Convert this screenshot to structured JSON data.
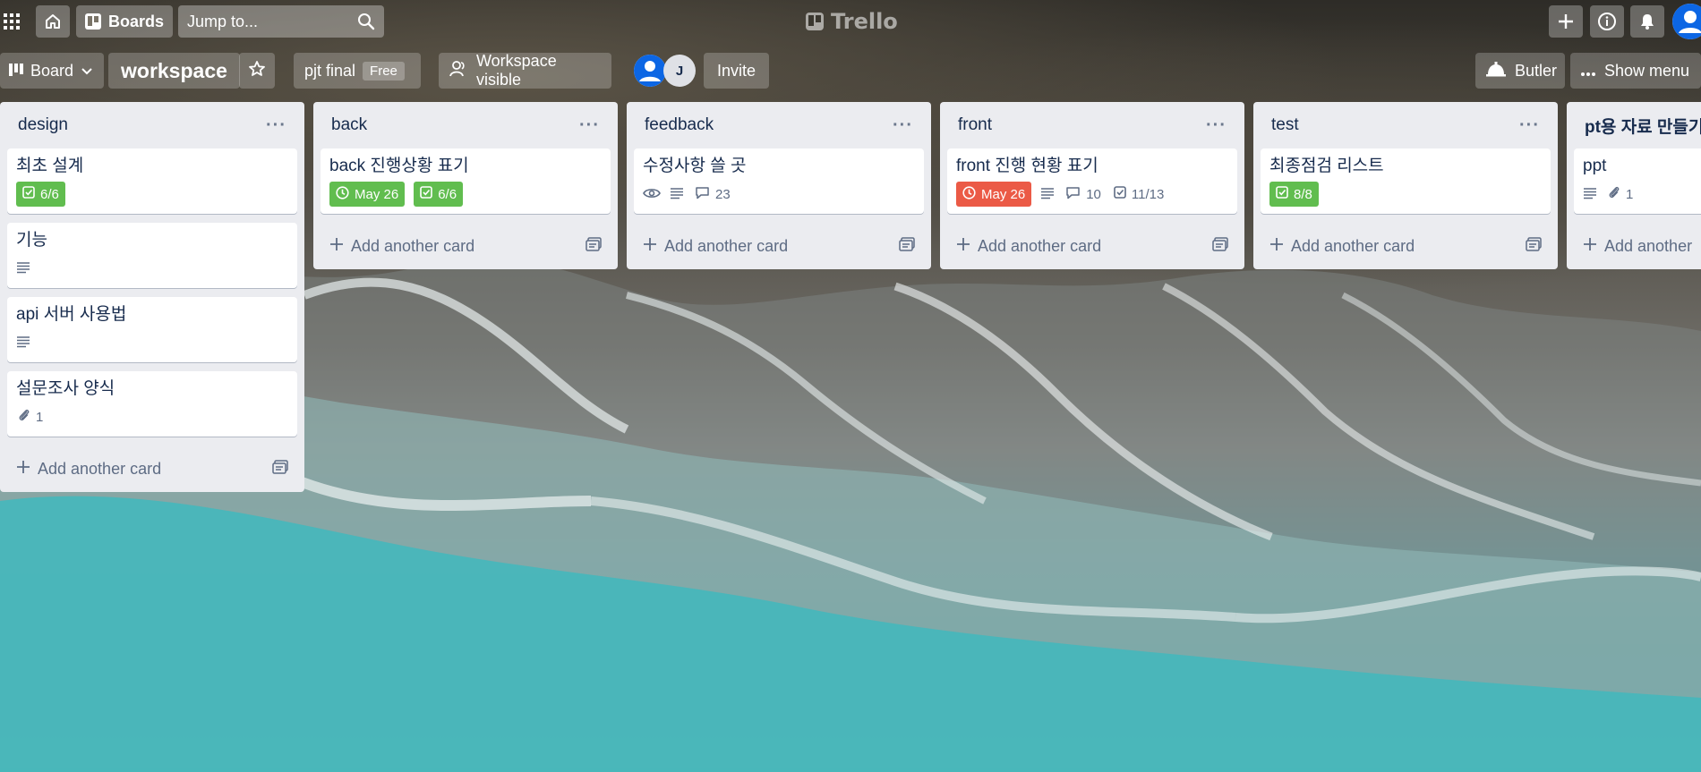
{
  "header": {
    "apps_icon": "grid-icon",
    "home_icon": "home-icon",
    "boards_label": "Boards",
    "search_placeholder": "Jump to...",
    "logo_text": "Trello",
    "create_icon": "plus-icon",
    "info_icon": "info-icon",
    "notifications_icon": "bell-icon",
    "account_icon": "user-avatar-icon"
  },
  "board_header": {
    "view_label": "Board",
    "board_name": "workspace",
    "workspace_name": "pjt final",
    "plan_badge": "Free",
    "visibility_label": "Workspace visible",
    "member_initial": "J",
    "invite_label": "Invite",
    "butler_label": "Butler",
    "show_menu_label": "Show menu"
  },
  "lists": [
    {
      "title": "design",
      "add_card_label": "Add another card",
      "cards": [
        {
          "title": "최초 설계",
          "checklist": "6/6"
        },
        {
          "title": "기능"
        },
        {
          "title": "api 서버 사용법"
        },
        {
          "title": "설문조사 양식",
          "attachments": "1"
        }
      ]
    },
    {
      "title": "back",
      "add_card_label": "Add another card",
      "cards": [
        {
          "title": "back 진행상황 표기",
          "due": "May 26",
          "checklist": "6/6"
        }
      ]
    },
    {
      "title": "feedback",
      "add_card_label": "Add another card",
      "cards": [
        {
          "title": "수정사항 쓸 곳",
          "comments": "23"
        }
      ]
    },
    {
      "title": "front",
      "add_card_label": "Add another card",
      "cards": [
        {
          "title": "front 진행 현황 표기",
          "due": "May 26",
          "comments": "10",
          "checklist": "11/13"
        }
      ]
    },
    {
      "title": "test",
      "add_card_label": "Add another card",
      "cards": [
        {
          "title": "최종점검 리스트",
          "checklist": "8/8"
        }
      ]
    },
    {
      "title": "pt용 자료 만들기",
      "add_card_label": "Add another",
      "cards": [
        {
          "title": "ppt",
          "attachments": "1"
        }
      ]
    }
  ],
  "colors": {
    "green_badge": "#61bd4f",
    "red_badge": "#eb5a46",
    "list_bg": "#ebecf0",
    "text": "#172b4d"
  }
}
